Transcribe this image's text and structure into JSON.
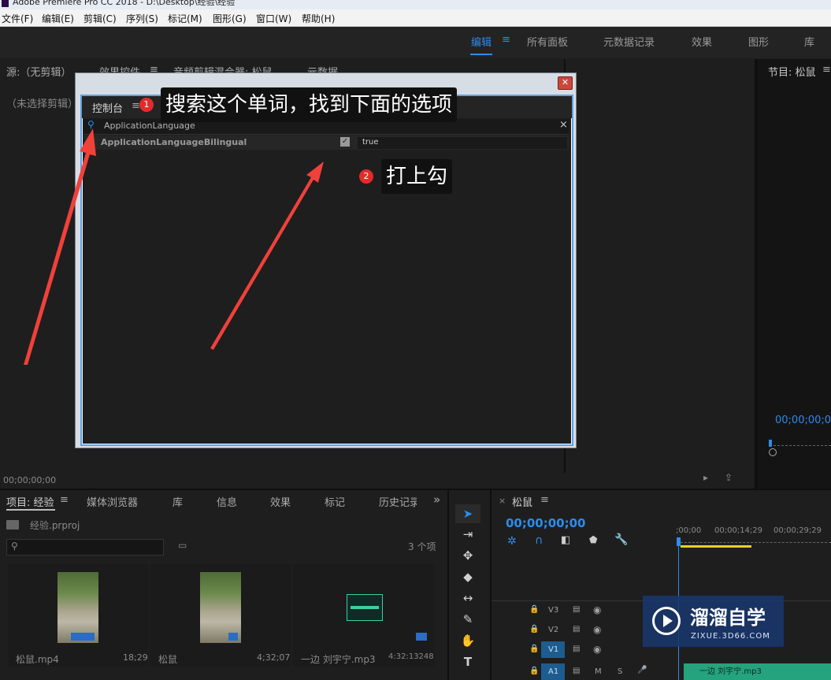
{
  "window": {
    "title": "Adobe Premiere Pro CC 2018 - D:\\Desktop\\经验\\经验"
  },
  "menu": [
    "文件(F)",
    "编辑(E)",
    "剪辑(C)",
    "序列(S)",
    "标记(M)",
    "图形(G)",
    "窗口(W)",
    "帮助(H)"
  ],
  "workspaces": {
    "active": "编辑",
    "items": [
      "所有面板",
      "元数据记录",
      "效果",
      "图形",
      "库"
    ]
  },
  "source_panel": {
    "tabs": [
      "源:（无剪辑）",
      "效果控件",
      "音频剪辑混合器: 松鼠",
      "元数据"
    ],
    "no_clip_text": "（未选择剪辑）",
    "timecode": "00;00;00;00"
  },
  "program_panel": {
    "title": "节目: 松鼠",
    "timecode": "00;00;00;0"
  },
  "console_dialog": {
    "tab": "控制台",
    "search_value": "ApplicationLanguage",
    "row": {
      "name": "ApplicationLanguageBilingual",
      "checked": true,
      "value": "true"
    },
    "callout1": {
      "num": "1",
      "text": "搜索这个单词，找到下面的选项"
    },
    "callout2": {
      "num": "2",
      "text": "打上勾"
    }
  },
  "project_panel": {
    "tabs": [
      "项目: 经验",
      "媒体浏览器",
      "库",
      "信息",
      "效果",
      "标记",
      "历史记录"
    ],
    "file": "经验.prproj",
    "count": "3 个项",
    "items": [
      {
        "name": "松鼠.mp4",
        "duration": "18;29"
      },
      {
        "name": "松鼠",
        "duration": "4;32;07"
      },
      {
        "name": "一边 刘宇宁.mp3",
        "duration": "4:32:13248"
      }
    ]
  },
  "timeline": {
    "title": "松鼠",
    "timecode": "00;00;00;00",
    "ruler": [
      ";00;00",
      "00;00;14;29",
      "00;00;29;29"
    ],
    "tracks": [
      "V3",
      "V2",
      "V1",
      "A1"
    ],
    "audio_clip": "一边 刘宇宁.mp3",
    "mute": "M",
    "solo": "S"
  },
  "watermark": {
    "cn": "溜溜自学",
    "url": "ZIXUE.3D66.COM"
  }
}
